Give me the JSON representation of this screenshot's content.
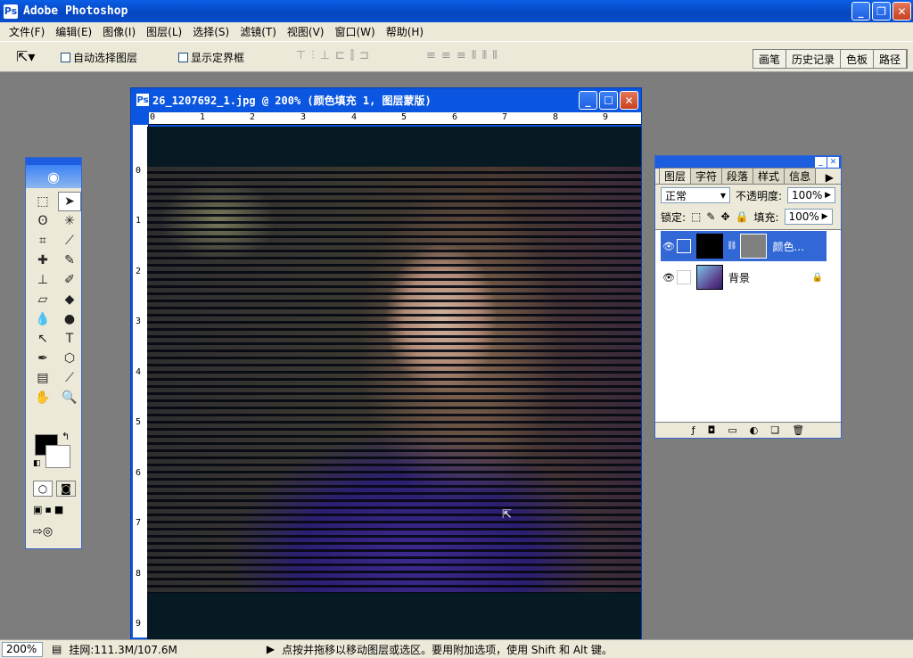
{
  "app": {
    "title": "Adobe Photoshop",
    "icon": "photoshop-icon"
  },
  "menu": [
    "文件(F)",
    "编辑(E)",
    "图像(I)",
    "图层(L)",
    "选择(S)",
    "滤镜(T)",
    "视图(V)",
    "窗口(W)",
    "帮助(H)"
  ],
  "options": {
    "auto_select": "自动选择图层",
    "show_bounds": "显示定界框",
    "wells": [
      "画笔",
      "历史记录",
      "色板",
      "路径"
    ]
  },
  "document": {
    "title": "26_1207692_1.jpg @ 200% (颜色填充 1, 图层蒙版)",
    "h_ruler": [
      "0",
      "1",
      "2",
      "3",
      "4",
      "5",
      "6",
      "7",
      "8",
      "9"
    ],
    "v_ruler": [
      "0",
      "1",
      "2",
      "3",
      "4",
      "5",
      "6",
      "7",
      "8",
      "9"
    ]
  },
  "layers_panel": {
    "tabs": [
      "图层",
      "字符",
      "段落",
      "样式",
      "信息"
    ],
    "blend_mode": "正常",
    "opacity_label": "不透明度:",
    "opacity_value": "100%",
    "lock_label": "锁定:",
    "fill_label": "填充:",
    "fill_value": "100%",
    "layers": [
      {
        "name": "颜色...",
        "selected": true
      },
      {
        "name": "背景",
        "selected": false
      }
    ]
  },
  "status": {
    "zoom": "200%",
    "doc_size": "挂网:111.3M/107.6M",
    "hint": "点按并拖移以移动图层或选区。要用附加选项，使用 Shift 和 Alt 键。"
  },
  "colors": {
    "title_blue": "#0a56e0",
    "foreground": "#000000",
    "background": "#ffffff",
    "layer_selected": "#3168d5"
  }
}
